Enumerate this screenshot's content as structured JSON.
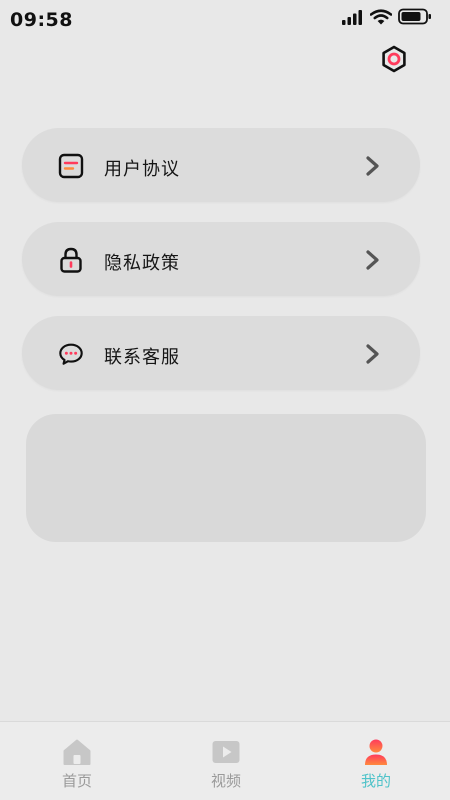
{
  "status_bar": {
    "time": "09:58"
  },
  "header": {
    "settings_icon": "settings-gear-icon"
  },
  "menu": {
    "items": [
      {
        "label": "用户协议",
        "icon": "agreement-document-icon"
      },
      {
        "label": "隐私政策",
        "icon": "lock-icon"
      },
      {
        "label": "联系客服",
        "icon": "chat-bubble-icon"
      }
    ]
  },
  "tabs": {
    "items": [
      {
        "label": "首页",
        "icon": "home-icon"
      },
      {
        "label": "视频",
        "icon": "video-play-icon"
      },
      {
        "label": "我的",
        "icon": "user-profile-icon",
        "active": true
      }
    ],
    "active_color": "#4fc3c9"
  },
  "colors": {
    "accent_red": "#ff3b5c",
    "accent_orange": "#ff8a3d",
    "background": "#e8e8e8",
    "card": "#dcdcdc"
  }
}
